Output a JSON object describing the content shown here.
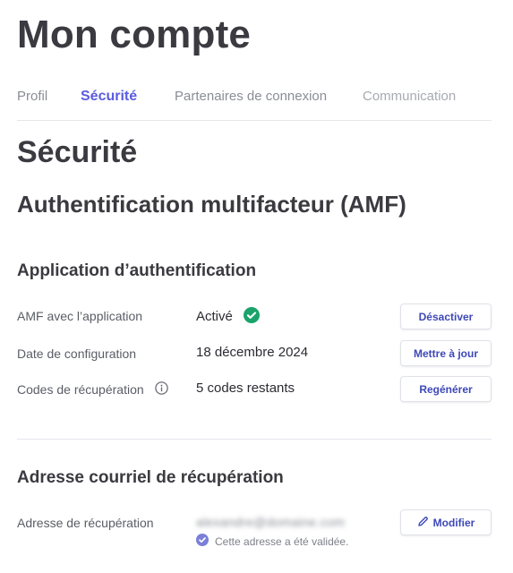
{
  "header": {
    "title": "Mon compte"
  },
  "tabs": [
    {
      "label": "Profil"
    },
    {
      "label": "Sécurité"
    },
    {
      "label": "Partenaires de connexion"
    },
    {
      "label": "Communication"
    }
  ],
  "section": {
    "title": "Sécurité",
    "subtitle": "Authentification multifacteur (AMF)"
  },
  "auth_app": {
    "heading": "Application d’authentification",
    "rows": [
      {
        "label": "AMF avec l’application",
        "value": "Activé",
        "button": "Désactiver"
      },
      {
        "label": "Date de configuration",
        "value": "18 décembre 2024",
        "button": "Mettre à jour"
      },
      {
        "label": "Codes de récupération",
        "value": "5 codes restants",
        "button": "Regénérer"
      }
    ]
  },
  "recovery_email": {
    "heading": "Adresse courriel de récupération",
    "label": "Adresse de récupération",
    "value": "alexandre@domaine.com",
    "validated_text": "Cette adresse a été validée.",
    "button": "Modifier"
  },
  "colors": {
    "accent": "#5b5ce0",
    "button_text": "#3d48b8",
    "success": "#1aa36b",
    "validated_badge": "#7b7fd9"
  }
}
